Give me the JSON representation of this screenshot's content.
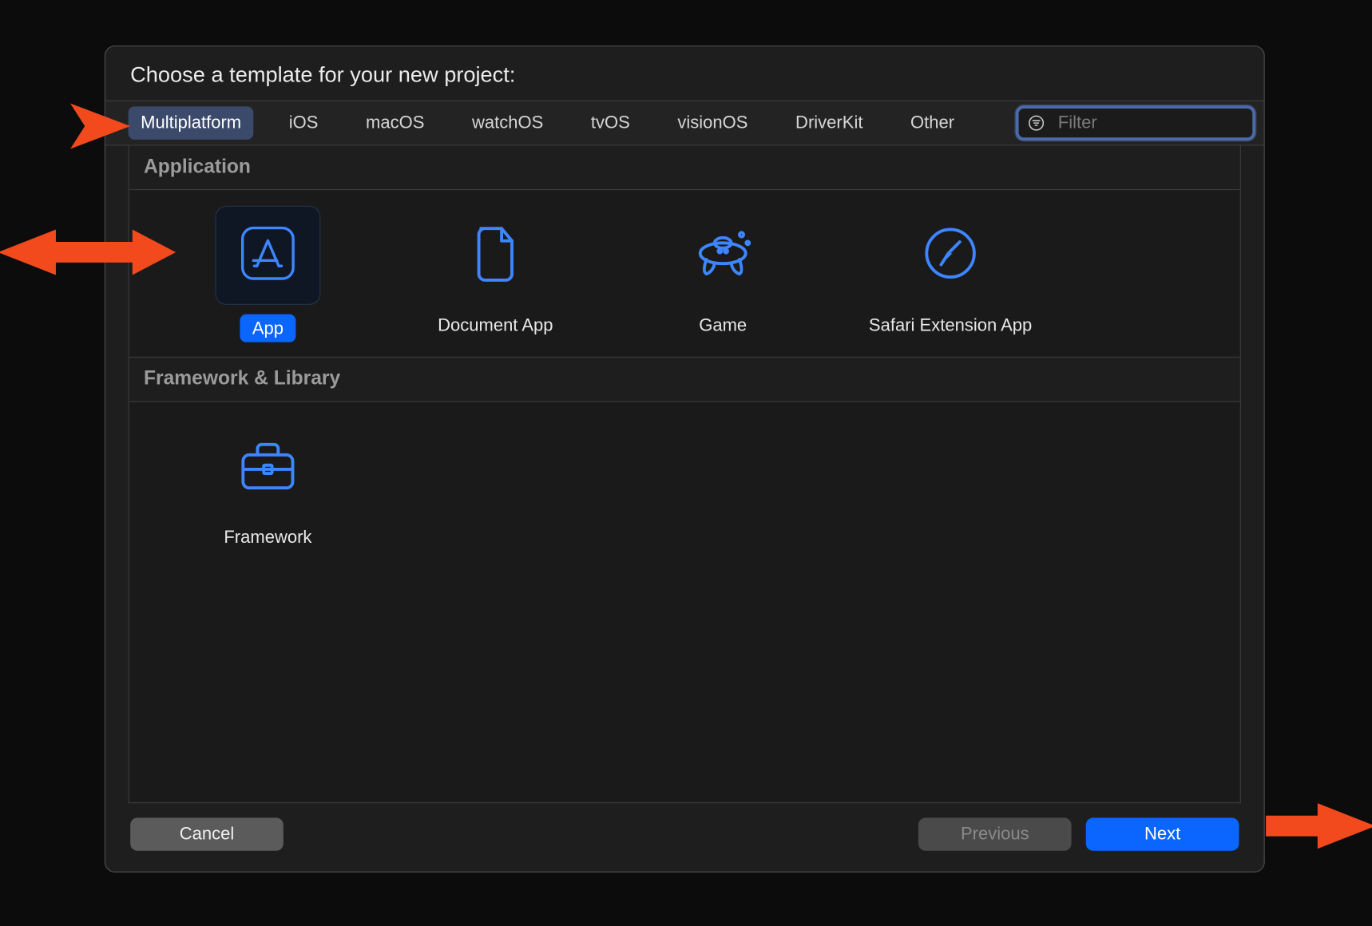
{
  "title": "Choose a template for your new project:",
  "tabs": [
    {
      "label": "Multiplatform",
      "selected": true
    },
    {
      "label": "iOS",
      "selected": false
    },
    {
      "label": "macOS",
      "selected": false
    },
    {
      "label": "watchOS",
      "selected": false
    },
    {
      "label": "tvOS",
      "selected": false
    },
    {
      "label": "visionOS",
      "selected": false
    },
    {
      "label": "DriverKit",
      "selected": false
    },
    {
      "label": "Other",
      "selected": false
    }
  ],
  "filter": {
    "placeholder": "Filter",
    "value": ""
  },
  "sections": {
    "application": {
      "header": "Application",
      "items": [
        {
          "label": "App",
          "icon": "app-icon",
          "selected": true
        },
        {
          "label": "Document App",
          "icon": "document-icon",
          "selected": false
        },
        {
          "label": "Game",
          "icon": "game-icon",
          "selected": false
        },
        {
          "label": "Safari Extension App",
          "icon": "safari-icon",
          "selected": false
        }
      ]
    },
    "framework": {
      "header": "Framework & Library",
      "items": [
        {
          "label": "Framework",
          "icon": "toolbox-icon",
          "selected": false
        }
      ]
    }
  },
  "buttons": {
    "cancel": "Cancel",
    "previous": "Previous",
    "next": "Next"
  },
  "colors": {
    "accent": "#0a66ff",
    "icon": "#3d86ff",
    "arrow": "#f24a1d"
  }
}
